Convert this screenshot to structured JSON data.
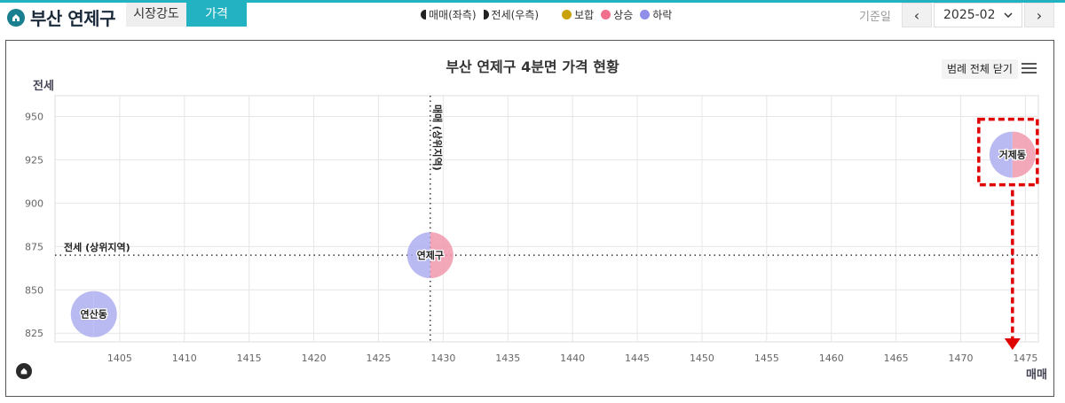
{
  "header": {
    "title": "부산 연제구",
    "tabs": [
      {
        "label": "시장강도",
        "active": false
      },
      {
        "label": "가격",
        "active": true
      }
    ],
    "legend": {
      "sale_left": "매매(좌측)",
      "lease_right": "전세(우측)",
      "flat": "보합",
      "up": "상승",
      "down": "하락"
    },
    "base_date_label": "기준일",
    "date_value": "2025-02",
    "prev_icon": "chevron-left-icon",
    "next_icon": "chevron-right-icon"
  },
  "colors": {
    "accent": "#22b2c2",
    "flat": "#c9a20a",
    "up": "#f0708e",
    "down": "#8f8ee8"
  },
  "toolbar": {
    "legend_close_label": "범례 전체 닫기",
    "menu_icon": "hamburger-menu-icon"
  },
  "chart_data": {
    "type": "scatter",
    "title": "부산 연제구 4분면 가격 현황",
    "xlabel": "매매",
    "ylabel": "전세",
    "xlim": [
      1400,
      1476
    ],
    "ylim": [
      820,
      962
    ],
    "xticks": [
      1405,
      1410,
      1415,
      1420,
      1425,
      1430,
      1435,
      1440,
      1445,
      1450,
      1455,
      1460,
      1465,
      1470,
      1475
    ],
    "yticks": [
      825,
      850,
      875,
      900,
      925,
      950
    ],
    "grid": true,
    "reference_lines": {
      "x": {
        "value": 1429,
        "label": "매매 (상위지역)"
      },
      "y": {
        "value": 870,
        "label": "전세 (상위지역)"
      }
    },
    "points": [
      {
        "name": "연산동",
        "x": 1403,
        "y": 836,
        "sale_trend": "하락",
        "lease_trend": "하락"
      },
      {
        "name": "연제구",
        "x": 1429,
        "y": 870,
        "sale_trend": "하락",
        "lease_trend": "상승"
      },
      {
        "name": "거제동",
        "x": 1474,
        "y": 928,
        "sale_trend": "하락",
        "lease_trend": "상승"
      }
    ]
  }
}
